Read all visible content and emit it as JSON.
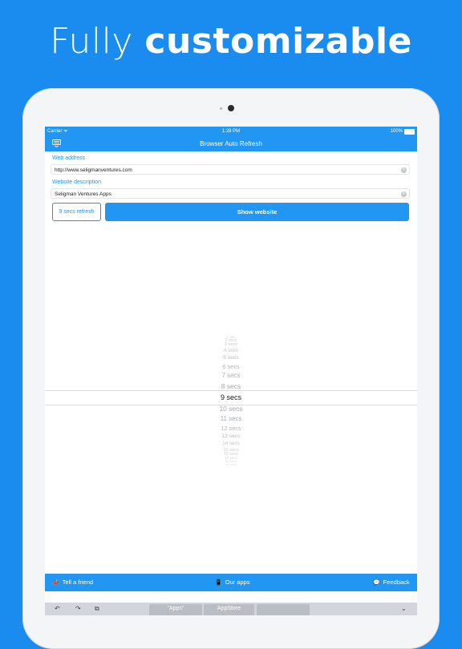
{
  "headline": {
    "light": "Fully",
    "bold": "customizable"
  },
  "status_bar": {
    "carrier": "Carrier",
    "time": "1:28 PM",
    "battery": "100%"
  },
  "nav_bar": {
    "title": "Browser Auto Refresh",
    "menu_icon": "keyboard-icon"
  },
  "form": {
    "web_address_label": "Web address",
    "web_address_value": "http://www.seligmanventures.com",
    "description_label": "Website description",
    "description_value": "Seligman Ventures Apps",
    "refresh_button": "9 secs refresh",
    "show_button": "Show website"
  },
  "picker": {
    "items": [
      "1 sec",
      "2 secs",
      "3 secs",
      "4 secs",
      "5 secs",
      "6 secs",
      "7 secs",
      "8 secs",
      "9 secs",
      "10 secs",
      "11 secs",
      "12 secs",
      "13 secs",
      "14 secs",
      "15 secs",
      "16 secs",
      "17 secs",
      "18 secs",
      "19 secs"
    ],
    "selected": "9 secs"
  },
  "bottom_bar": {
    "tell_friend": "Tell a friend",
    "our_apps": "Our apps",
    "feedback": "Feedback"
  },
  "keyboard_bar": {
    "suggestions": [
      "\"Apps\"",
      "AppStore",
      ""
    ],
    "tools": [
      "↶",
      "↷",
      "⧉",
      "⌄"
    ]
  },
  "colors": {
    "background": "#1a8cf0",
    "accent": "#2196f3"
  }
}
